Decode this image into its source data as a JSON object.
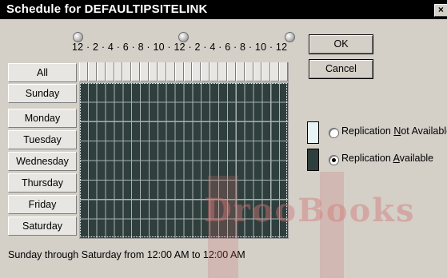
{
  "window": {
    "title": "Schedule for DEFAULTIPSITELINK",
    "close_glyph": "×"
  },
  "hours": {
    "labels": "12 · 2 · 4 · 6 · 8 · 10 · 12 · 2 · 4 · 6 · 8 · 10 · 12"
  },
  "rows": {
    "all": "All",
    "days": [
      "Sunday",
      "Monday",
      "Tuesday",
      "Wednesday",
      "Thursday",
      "Friday",
      "Saturday"
    ]
  },
  "buttons": {
    "ok": "OK",
    "cancel": "Cancel"
  },
  "legend": {
    "not_available": {
      "pre": "Replication ",
      "u": "N",
      "post": "ot Available",
      "color": "#e6f4f6"
    },
    "available": {
      "pre": "Replication ",
      "u": "A",
      "post": "vailable",
      "color": "#2f3f3d",
      "selected": true
    }
  },
  "status": "Sunday through Saturday from 12:00 AM to 12:00 AM",
  "watermark": "DrooBooks"
}
